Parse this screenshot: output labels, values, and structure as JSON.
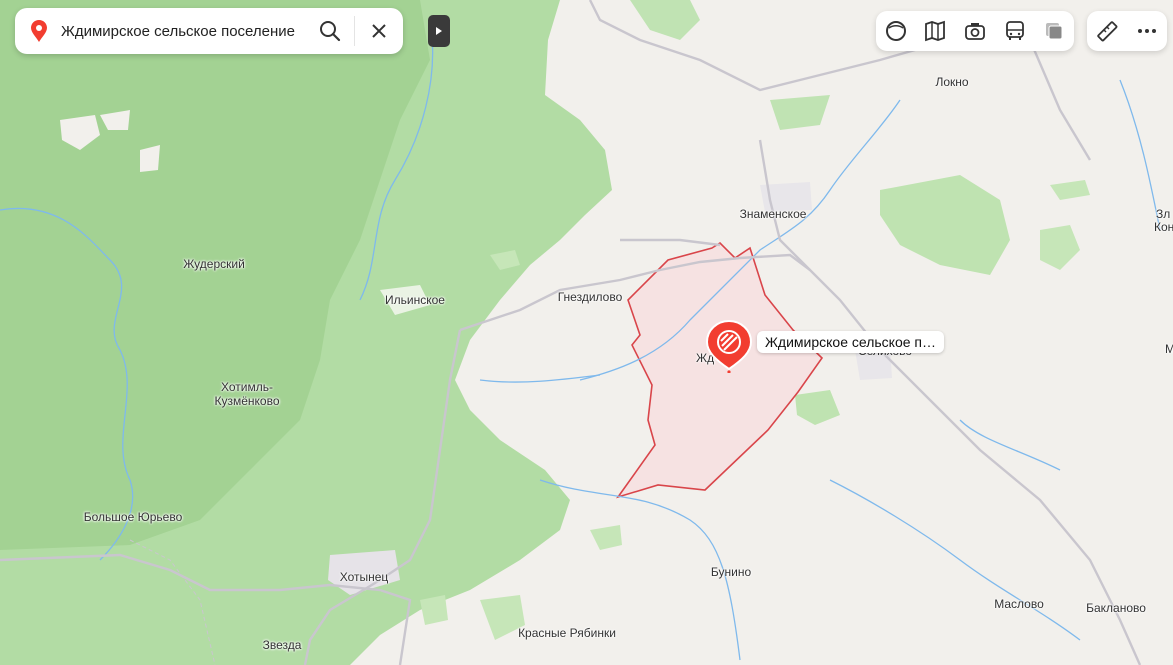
{
  "search": {
    "query": "Ждимирское сельское поселение",
    "search_icon": "search-icon",
    "clear_icon": "close-icon"
  },
  "colors": {
    "forest": "#a8d59c",
    "forest_light": "#c6e5ba",
    "land": "#f2f0ec",
    "water": "#7fb9ec",
    "road": "#c9c6ce",
    "area_fill": "#f7dfe1",
    "area_border": "#d9454a",
    "marker": "#f23d30"
  },
  "toolbar": {
    "items": [
      "layers-icon",
      "map-book-icon",
      "panorama-camera-icon",
      "public-transport-icon",
      "overlay-icon"
    ],
    "extra": [
      "ruler-icon",
      "more-icon"
    ]
  },
  "selected_area": {
    "label": "Ждимирское сельское п…"
  },
  "places": {
    "lokno": "Локно",
    "znamenskoe": "Знаменское",
    "zhuderskiy": "Жудерский",
    "ilinskoe": "Ильинское",
    "gnezdilovo": "Гнездилово",
    "hotiml": "Хотимль-\nКузмёнково",
    "bolshoe_yurevo": "Большое Юрьево",
    "hotynets": "Хотынец",
    "zvezda": "Звезда",
    "krasnye_ryabinki": "Красные Рябинки",
    "bunino": "Бунино",
    "maslovo": "Маслово",
    "baklanovo": "Бакланово",
    "selikhovo": "Селихово",
    "zhd": "Жд",
    "edge_zl": "Зл",
    "edge_kon": "Кон",
    "edge_m": "М"
  }
}
